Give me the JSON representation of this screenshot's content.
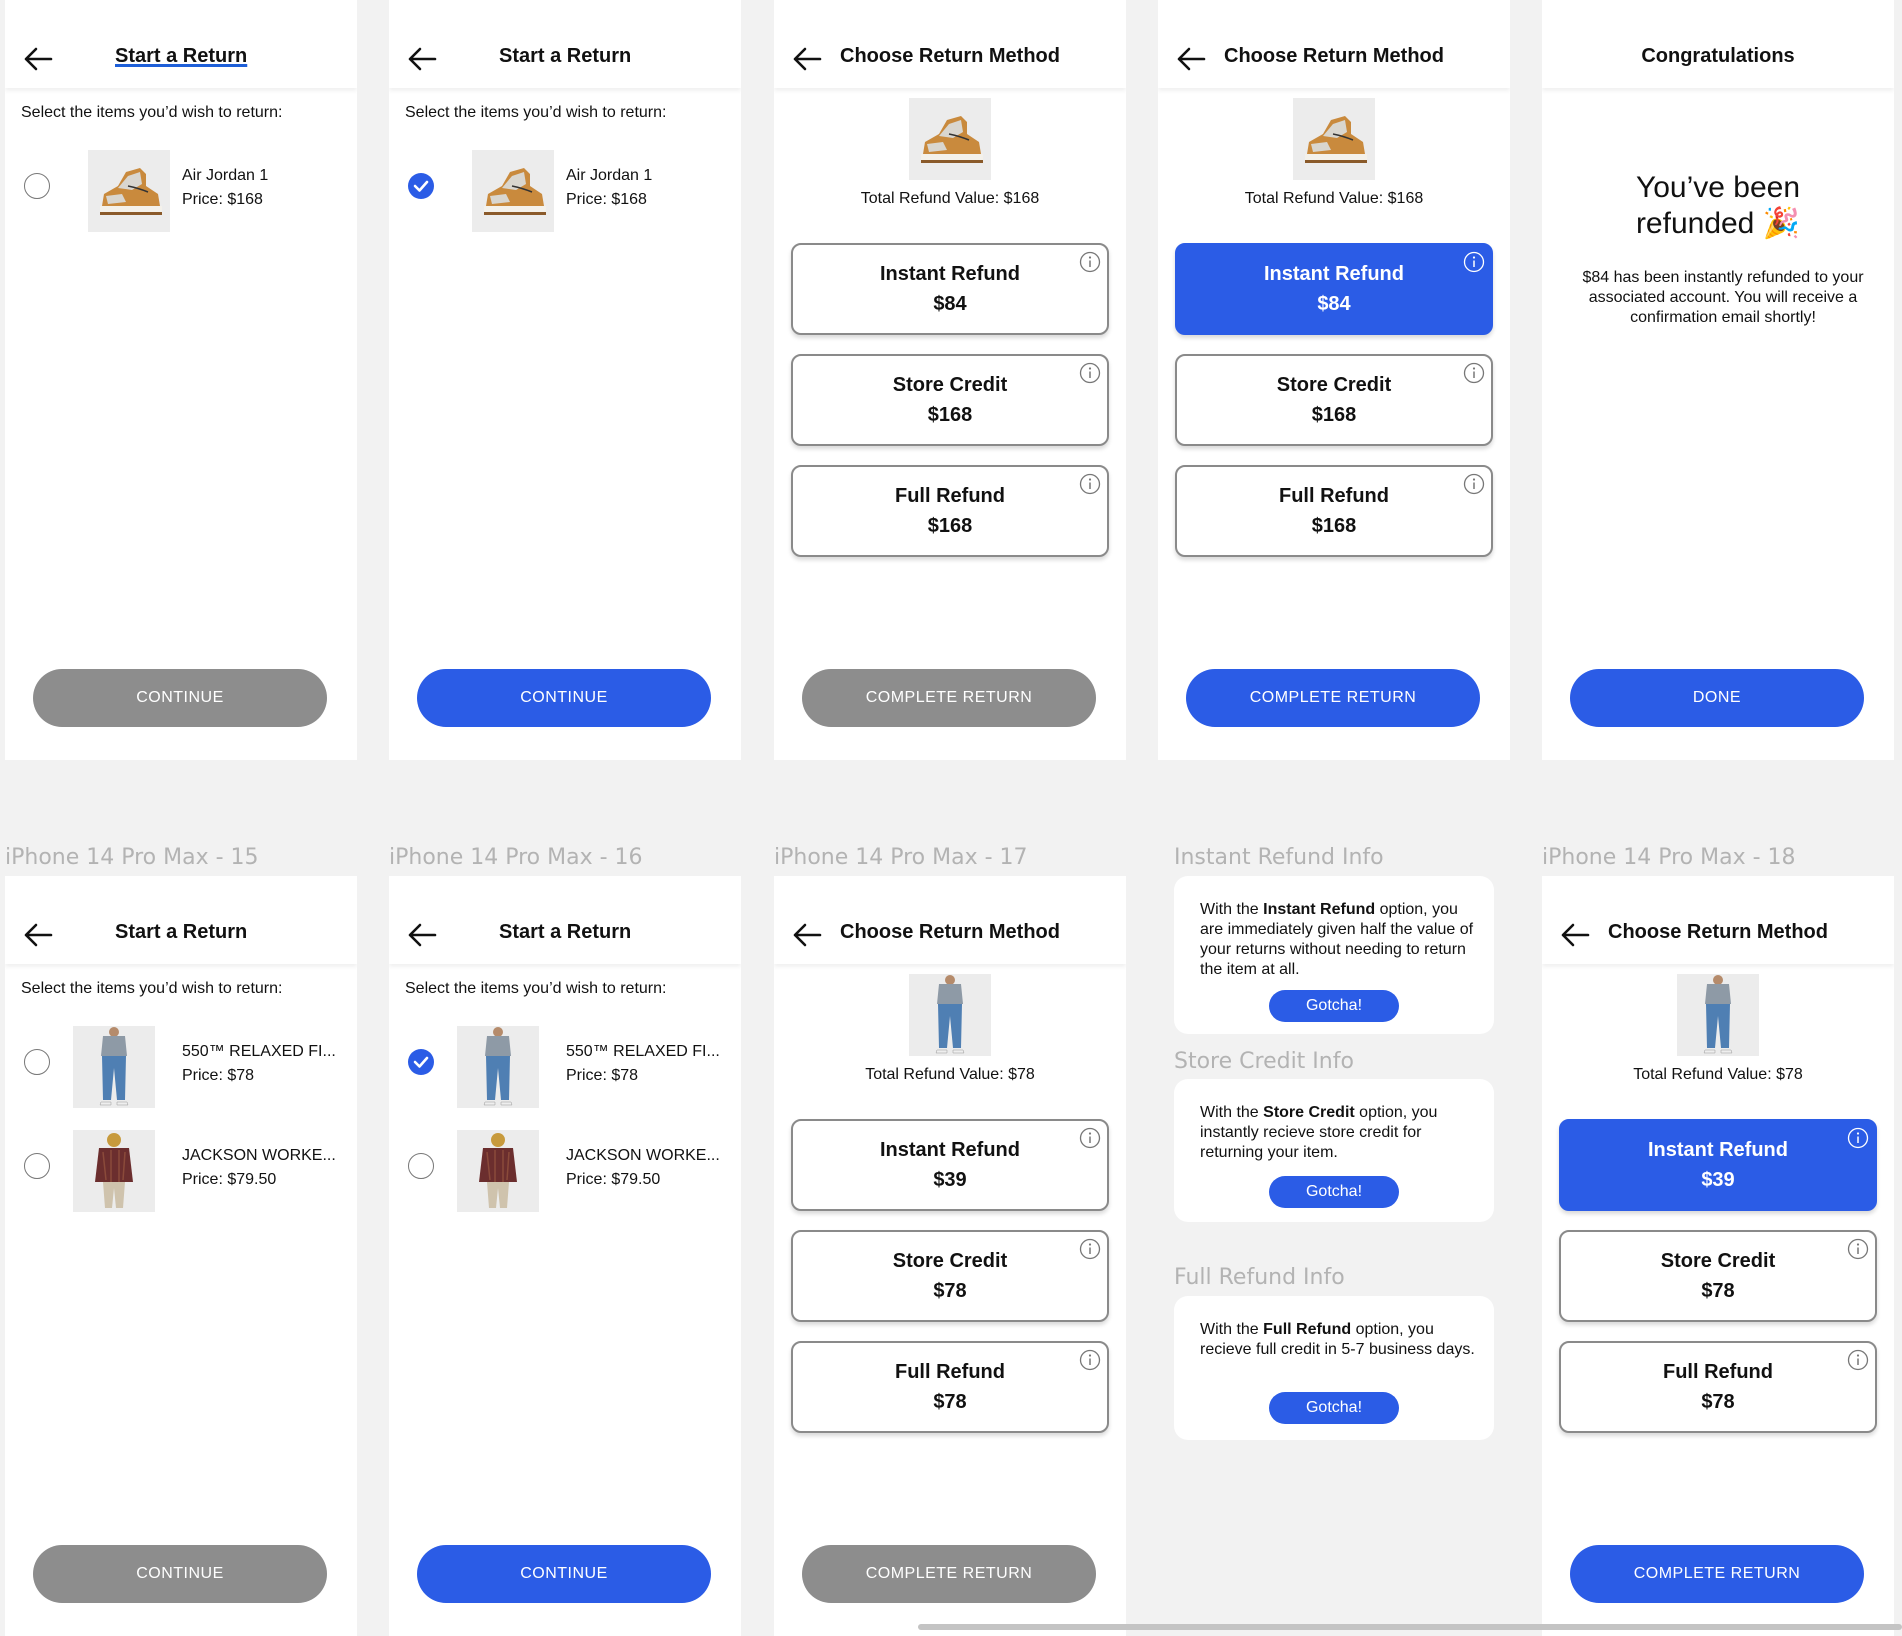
{
  "frames": {
    "f1": {
      "title": "Start a Return",
      "prompt": "Select the items you’d wish to return:",
      "items": [
        {
          "name": "Air Jordan 1",
          "price": "Price: $168"
        }
      ],
      "cta": "CONTINUE"
    },
    "f2": {
      "title": "Start a Return",
      "prompt": "Select the items you’d wish to return:",
      "items": [
        {
          "name": "Air Jordan 1",
          "price": "Price: $168"
        }
      ],
      "cta": "CONTINUE"
    },
    "f3": {
      "title": "Choose Return Method",
      "total": "Total Refund Value: $168",
      "options": [
        {
          "name": "Instant Refund",
          "amount": "$84"
        },
        {
          "name": "Store Credit",
          "amount": "$168"
        },
        {
          "name": "Full Refund",
          "amount": "$168"
        }
      ],
      "cta": "COMPLETE RETURN"
    },
    "f4": {
      "title": "Choose Return Method",
      "total": "Total Refund Value: $168",
      "options": [
        {
          "name": "Instant Refund",
          "amount": "$84"
        },
        {
          "name": "Store Credit",
          "amount": "$168"
        },
        {
          "name": "Full Refund",
          "amount": "$168"
        }
      ],
      "cta": "COMPLETE RETURN"
    },
    "f5": {
      "title": "Congratulations",
      "big_line1": "You’ve been",
      "big_line2": "refunded 🎉",
      "message": "$84 has been instantly refunded to your associated account. You will receive a confirmation email shortly!",
      "cta": "DONE"
    },
    "f6": {
      "label": "iPhone 14 Pro Max - 15",
      "title": "Start a Return",
      "prompt": "Select the items you’d wish to return:",
      "items": [
        {
          "name": "550™ RELAXED FI...",
          "price": "Price: $78"
        },
        {
          "name": "JACKSON WORKE...",
          "price": "Price: $79.50"
        }
      ],
      "cta": "CONTINUE"
    },
    "f7": {
      "label": "iPhone 14 Pro Max - 16",
      "title": "Start a Return",
      "prompt": "Select the items you’d wish to return:",
      "items": [
        {
          "name": "550™ RELAXED FI...",
          "price": "Price: $78"
        },
        {
          "name": "JACKSON WORKE...",
          "price": "Price: $79.50"
        }
      ],
      "cta": "CONTINUE"
    },
    "f8": {
      "label": "iPhone 14 Pro Max - 17",
      "title": "Choose Return Method",
      "total": "Total Refund Value: $78",
      "options": [
        {
          "name": "Instant Refund",
          "amount": "$39"
        },
        {
          "name": "Store Credit",
          "amount": "$78"
        },
        {
          "name": "Full Refund",
          "amount": "$78"
        }
      ],
      "cta": "COMPLETE RETURN"
    },
    "f10": {
      "label": "iPhone 14 Pro Max - 18",
      "title": "Choose Return Method",
      "total": "Total Refund Value: $78",
      "options": [
        {
          "name": "Instant Refund",
          "amount": "$39"
        },
        {
          "name": "Store Credit",
          "amount": "$78"
        },
        {
          "name": "Full Refund",
          "amount": "$78"
        }
      ],
      "cta": "COMPLETE RETURN"
    }
  },
  "info": {
    "instant": {
      "label": "Instant Refund Info",
      "pre": "With the ",
      "bold": "Instant Refund",
      "post": " option, you are immediately given half the value of your returns without needing to return the item at all.",
      "button": "Gotcha!"
    },
    "store": {
      "label": "Store Credit Info",
      "pre": "With the ",
      "bold": "Store Credit",
      "post": " option, you instantly recieve store credit for returning your item.",
      "button": "Gotcha!"
    },
    "full": {
      "label": "Full Refund Info",
      "pre": "With the ",
      "bold": "Full Refund",
      "post": " option, you recieve full credit in 5-7 business days.",
      "button": "Gotcha!"
    }
  },
  "colors": {
    "accent": "#2b5ce6",
    "disabled": "#8d8d8d",
    "background": "#f2f2f2"
  }
}
